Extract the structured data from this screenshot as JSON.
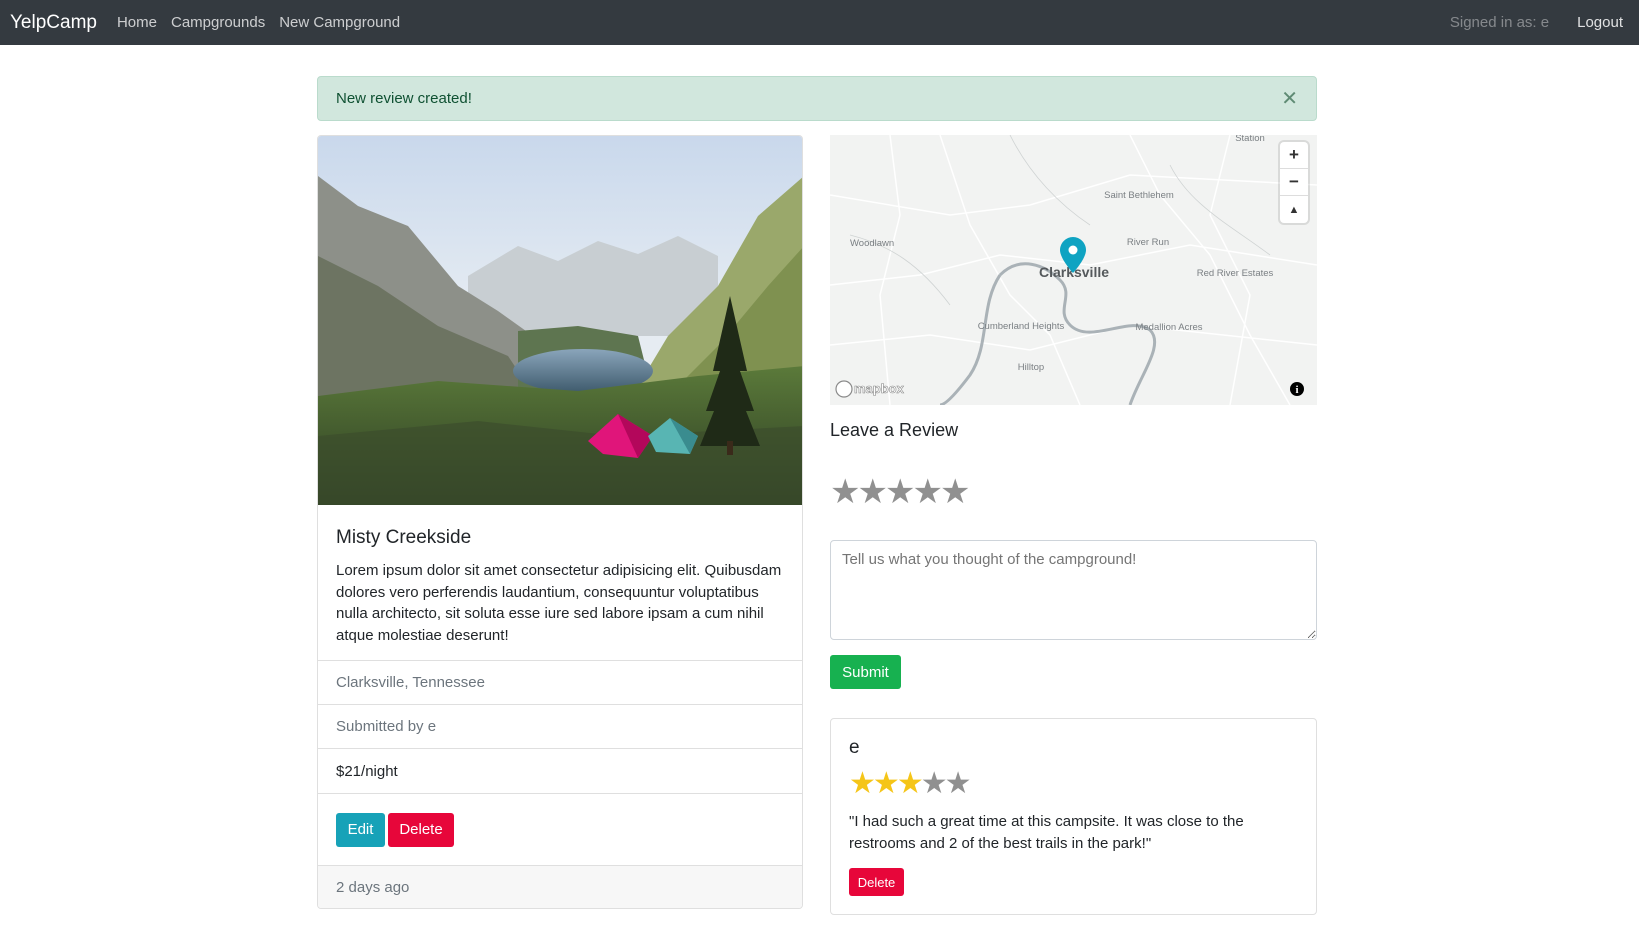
{
  "navbar": {
    "brand": "YelpCamp",
    "links": [
      "Home",
      "Campgrounds",
      "New Campground"
    ],
    "signed_in": "Signed in as: e",
    "logout": "Logout"
  },
  "alert": {
    "message": "New review created!",
    "close": "✕"
  },
  "campground": {
    "title": "Misty Creekside",
    "description": "Lorem ipsum dolor sit amet consectetur adipisicing elit. Quibusdam dolores vero perferendis laudantium, consequuntur voluptatibus nulla architecto, sit soluta esse iure sed labore ipsam a cum nihil atque molestiae deserunt!",
    "location": "Clarksville, Tennessee",
    "submitted_by": "Submitted by e",
    "price": "$21/night",
    "edit_label": "Edit",
    "delete_label": "Delete",
    "posted": "2 days ago"
  },
  "map": {
    "labels": [
      "Clarksville",
      "Woodlawn",
      "Saint Bethlehem",
      "River Run",
      "Red River Estates",
      "Cumberland Heights",
      "Medallion Acres",
      "Hilltop",
      "Station"
    ],
    "attribution": "mapbox",
    "zoom_in": "+",
    "zoom_out": "−",
    "compass": "▲"
  },
  "review_form": {
    "heading": "Leave a Review",
    "star_icon": "star-icon",
    "placeholder": "Tell us what you thought of the campground!",
    "submit_label": "Submit"
  },
  "reviews": [
    {
      "author": "e",
      "rating": 3,
      "max_rating": 5,
      "text": "\"I had such a great time at this campsite. It was close to the restrooms and 2 of the best trails in the park!\"",
      "delete_label": "Delete"
    }
  ],
  "colors": {
    "navbar": "#343a40",
    "alert_bg": "#d1e7dd",
    "edit": "#17a2b8",
    "delete": "#e7063a",
    "submit": "#17b150",
    "star_filled": "#f5c518",
    "star_empty": "#909090",
    "map_pin": "#0fa3c2"
  }
}
